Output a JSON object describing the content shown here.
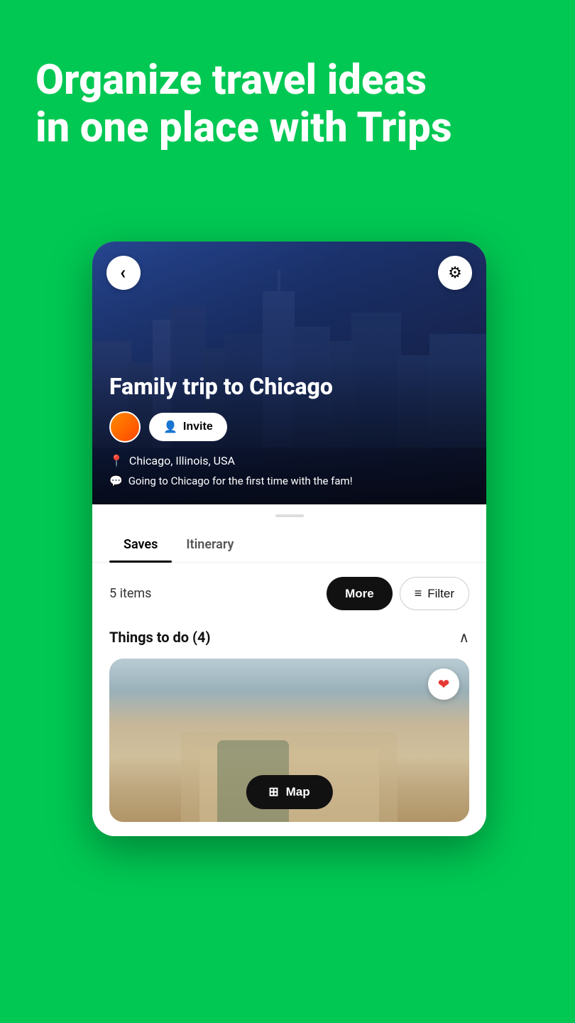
{
  "hero": {
    "title_line1": "Organize travel ideas",
    "title_line2": "in one place with Trips"
  },
  "trip": {
    "name": "Family trip to Chicago",
    "location": "Chicago, Illinois, USA",
    "note": "Going to Chicago for the first time with the fam!",
    "avatar_initials": ""
  },
  "buttons": {
    "back": "‹",
    "settings": "⚙",
    "invite": "Invite",
    "more": "More",
    "filter": "Filter",
    "map": "Map"
  },
  "tabs": [
    {
      "id": "saves",
      "label": "Saves",
      "active": true
    },
    {
      "id": "itinerary",
      "label": "Itinerary",
      "active": false
    }
  ],
  "items_count": "5 items",
  "sections": [
    {
      "title": "Things to do (4)",
      "expanded": true
    }
  ],
  "place_card": {
    "heart": "❤"
  }
}
